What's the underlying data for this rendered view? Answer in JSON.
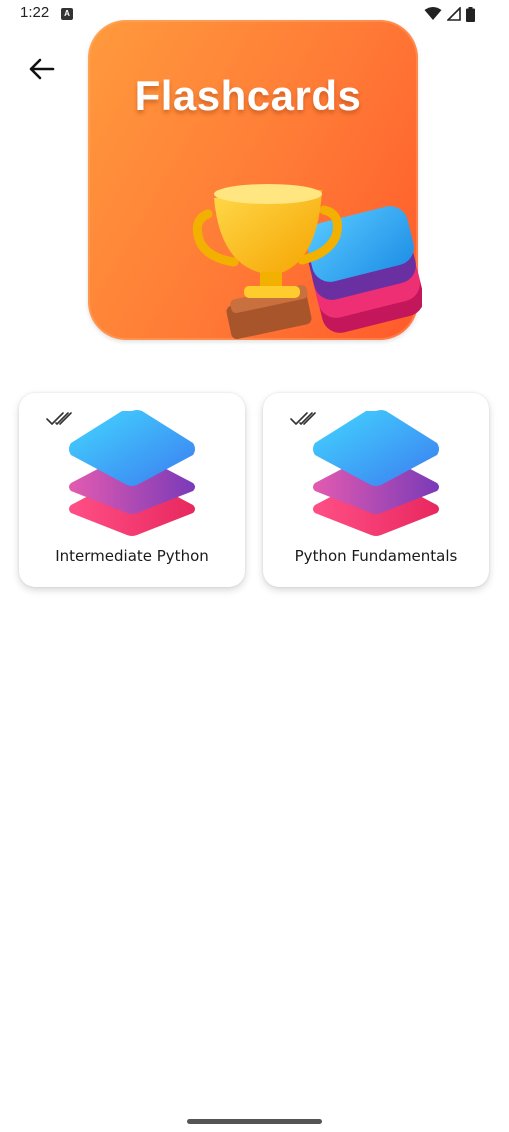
{
  "status_bar": {
    "time": "1:22",
    "notification_icon": "a-notification-icon",
    "icons": [
      "wifi-icon",
      "signal-icon",
      "battery-icon"
    ]
  },
  "header": {
    "back_icon": "arrow-left-icon",
    "hero_title": "Flashcards"
  },
  "decks": [
    {
      "label": "Intermediate Python",
      "status_icon": "double-check-icon",
      "icon": "layers-stack-icon"
    },
    {
      "label": "Python Fundamentals",
      "status_icon": "double-check-icon",
      "icon": "layers-stack-icon"
    }
  ],
  "colors": {
    "hero_orange": "#ff7a36",
    "stack_blue": "#2ab7f0",
    "stack_purple": "#8b3fb8",
    "stack_pink": "#f0306f"
  }
}
